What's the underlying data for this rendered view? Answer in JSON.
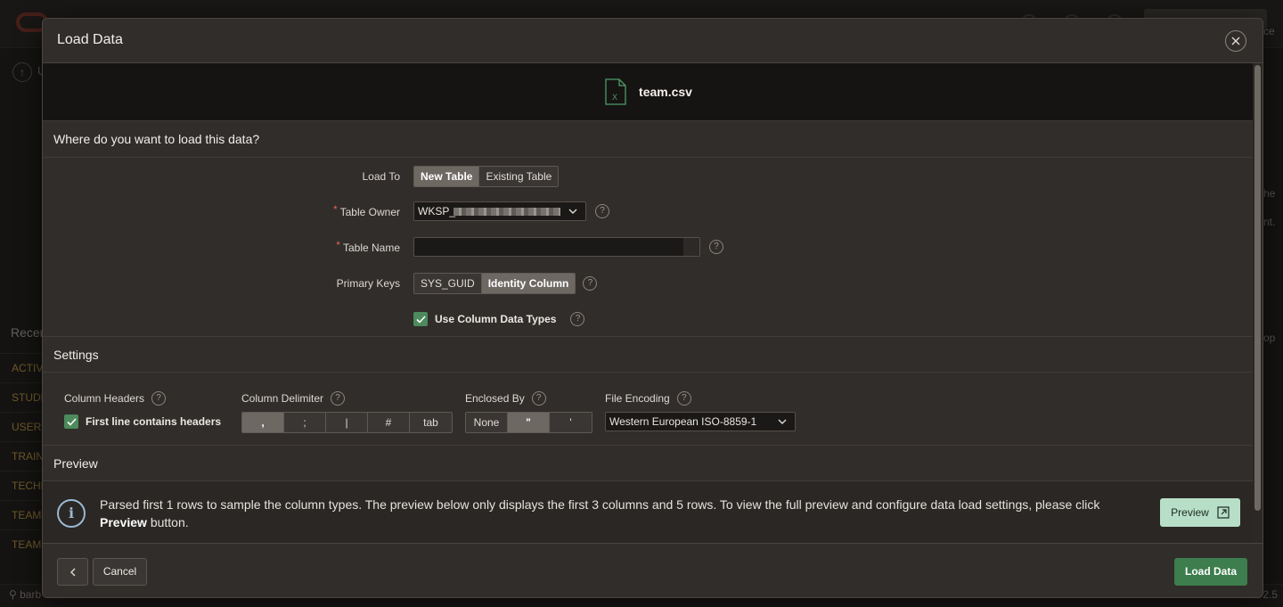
{
  "background": {
    "top_left_label": "U",
    "recent_heading": "Recen",
    "sidebar_items": [
      "ACTIV",
      "STUDE",
      "USERS",
      "TRAIN",
      "TECHN",
      "TEAM",
      "TEAM"
    ],
    "footer_user": "barb",
    "footer_version": "2.5",
    "right_fragments": [
      "ce",
      "he",
      "nt.",
      "op"
    ]
  },
  "dialog": {
    "title": "Load Data",
    "file": {
      "name": "team.csv",
      "icon": "excel-file-icon"
    },
    "destination": {
      "heading": "Where do you want to load this data?",
      "load_to": {
        "label": "Load To",
        "options": [
          "New Table",
          "Existing Table"
        ],
        "selected": "New Table"
      },
      "table_owner": {
        "label": "Table Owner",
        "required": true,
        "value": "WKSP_"
      },
      "table_name": {
        "label": "Table Name",
        "required": true,
        "value": ""
      },
      "primary_keys": {
        "label": "Primary Keys",
        "options": [
          "SYS_GUID",
          "Identity Column"
        ],
        "selected": "Identity Column"
      },
      "use_column_types": {
        "label": "Use Column Data Types",
        "checked": true
      }
    },
    "settings": {
      "heading": "Settings",
      "column_headers": {
        "label": "Column Headers",
        "checkbox_label": "First line contains headers",
        "checked": true
      },
      "column_delimiter": {
        "label": "Column Delimiter",
        "options": [
          ",",
          ";",
          "|",
          "#",
          "tab"
        ],
        "selected": ","
      },
      "enclosed_by": {
        "label": "Enclosed By",
        "options": [
          "None",
          "\"",
          "'"
        ],
        "selected": "\""
      },
      "file_encoding": {
        "label": "File Encoding",
        "value": "Western European ISO-8859-1"
      }
    },
    "preview": {
      "heading": "Preview",
      "message_1": "Parsed first 1 rows to sample the column types. The preview below only displays the first 3 columns and 5 rows. To view the full preview and configure data load settings, please click",
      "message_bold": "Preview",
      "message_2": "button.",
      "button_label": "Preview"
    },
    "footer": {
      "cancel_label": "Cancel",
      "load_label": "Load Data"
    }
  },
  "colors": {
    "primary_button": "#3d7d4e",
    "preview_button": "#b7dfc7",
    "checkbox": "#4d8a5c",
    "info": "#9bb8d3",
    "oracle_red": "#c74634"
  }
}
